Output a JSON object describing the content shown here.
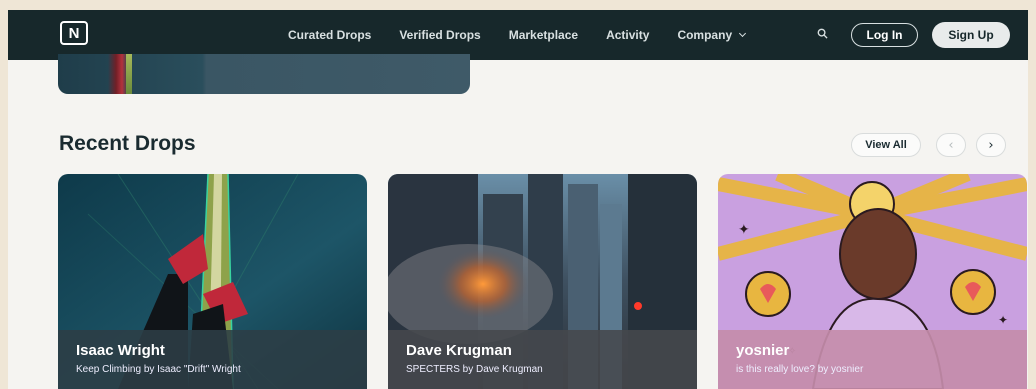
{
  "nav": {
    "logo": "N",
    "links": [
      "Curated Drops",
      "Verified Drops",
      "Marketplace",
      "Activity"
    ],
    "company": "Company",
    "login": "Log In",
    "signup": "Sign Up"
  },
  "section": {
    "title": "Recent Drops",
    "view_all": "View All",
    "prev": "‹",
    "next": "›"
  },
  "cards": [
    {
      "name": "Isaac Wright",
      "subtitle": "Keep Climbing by Isaac \"Drift\" Wright"
    },
    {
      "name": "Dave Krugman",
      "subtitle": "SPECTERS by Dave Krugman"
    },
    {
      "name": "yosnier",
      "subtitle": "is this really love? by yosnier"
    }
  ],
  "icons": {
    "logo": "nifty-logo-icon",
    "search": "search-icon",
    "chevron": "chevron-down-icon",
    "prev": "chevron-left-icon",
    "next": "chevron-right-icon"
  },
  "colors": {
    "nav_bg": "#17282b",
    "page_bg": "#f5f4f1",
    "heading": "#1a2b30"
  }
}
